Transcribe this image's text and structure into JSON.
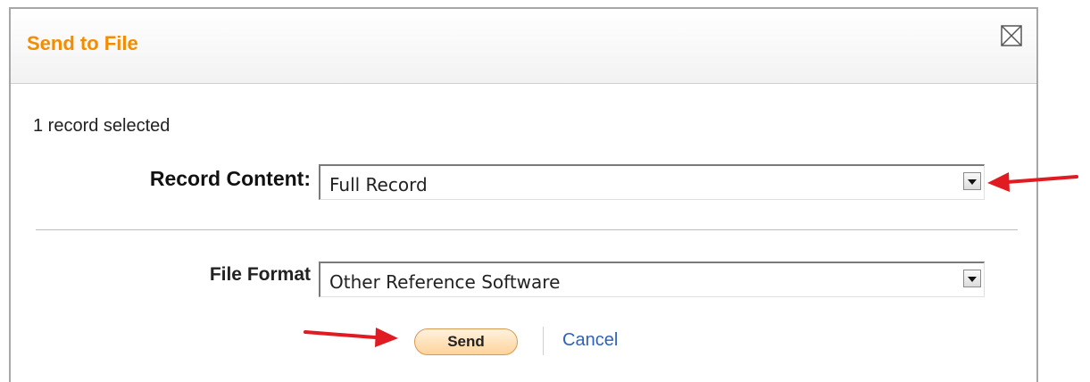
{
  "dialog": {
    "title": "Send to File",
    "close_icon": "close-x-icon"
  },
  "selection": {
    "count_text": "1 record selected"
  },
  "record_content": {
    "label": "Record Content:",
    "selected": "Full Record"
  },
  "file_format": {
    "label": "File Format",
    "selected": "Other Reference Software"
  },
  "actions": {
    "send_label": "Send",
    "cancel_label": "Cancel"
  },
  "annotations": {
    "arrow_icon": "red-arrow-icon",
    "arrow_color": "#e11b22"
  },
  "colors": {
    "title": "#f28c00",
    "link": "#2f62b8",
    "send_fill": "#ffd39a"
  }
}
